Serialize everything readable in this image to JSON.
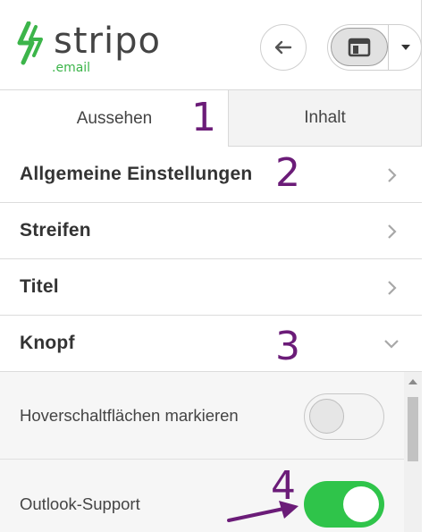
{
  "header": {
    "logo_word": "stripo",
    "logo_sub": ".email"
  },
  "tabs": [
    {
      "label": "Aussehen",
      "active": true
    },
    {
      "label": "Inhalt",
      "active": false
    }
  ],
  "sections": [
    {
      "label": "Allgemeine Einstellungen",
      "expanded": false
    },
    {
      "label": "Streifen",
      "expanded": false
    },
    {
      "label": "Titel",
      "expanded": false
    },
    {
      "label": "Knopf",
      "expanded": true
    }
  ],
  "settings": [
    {
      "label": "Hoverschaltflächen markieren",
      "enabled": false
    },
    {
      "label": "Outlook-Support",
      "enabled": true
    }
  ],
  "annotations": [
    "1",
    "2",
    "3",
    "4"
  ],
  "colors": {
    "brand_green": "#3cb54a",
    "toggle_on": "#2fc44a",
    "annotation": "#6b1c78"
  }
}
